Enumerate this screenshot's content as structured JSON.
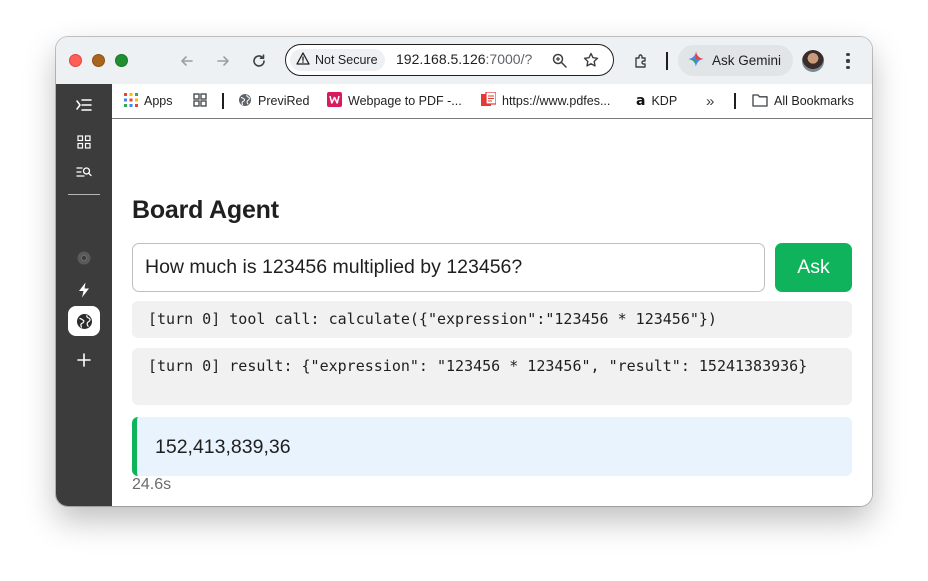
{
  "browser": {
    "security_label": "Not Secure",
    "url_host": "192.168.5.126",
    "url_rest": ":7000/?",
    "gemini_label": "Ask Gemini"
  },
  "bookmarks": [
    {
      "label": "Apps",
      "icon": "apps-grid-icon"
    },
    {
      "label": "",
      "icon": "tab-groups-icon"
    },
    {
      "label": "PreviRed",
      "icon": "globe-icon"
    },
    {
      "label": "Webpage to PDF -...",
      "icon": "w-logo-icon"
    },
    {
      "label": "https://www.pdfes...",
      "icon": "pdf-icon"
    },
    {
      "label": "KDP",
      "icon": "amazon-icon"
    },
    {
      "label": "All Bookmarks",
      "icon": "folder-icon"
    }
  ],
  "sidebar": {
    "items": [
      "collapse-icon",
      "apps-icon",
      "search-list-icon",
      "chrome-icon",
      "bolt-icon",
      "globe-icon",
      "add-icon"
    ]
  },
  "app": {
    "title": "Board Agent",
    "query_value": "How much is 123456 multiplied by 123456?",
    "ask_label": "Ask",
    "log_lines": [
      "[turn 0] tool call: calculate({\"expression\":\"123456 * 123456\"})",
      "[turn 0] result: {\"expression\": \"123456 * 123456\", \"result\": 15241383936}"
    ],
    "answer": "152,413,839,36",
    "elapsed": "24.6s"
  },
  "colors": {
    "accent_green": "#0fb35b",
    "answer_bg": "#e8f3fd",
    "sidebar_bg": "#3c3c3c"
  }
}
